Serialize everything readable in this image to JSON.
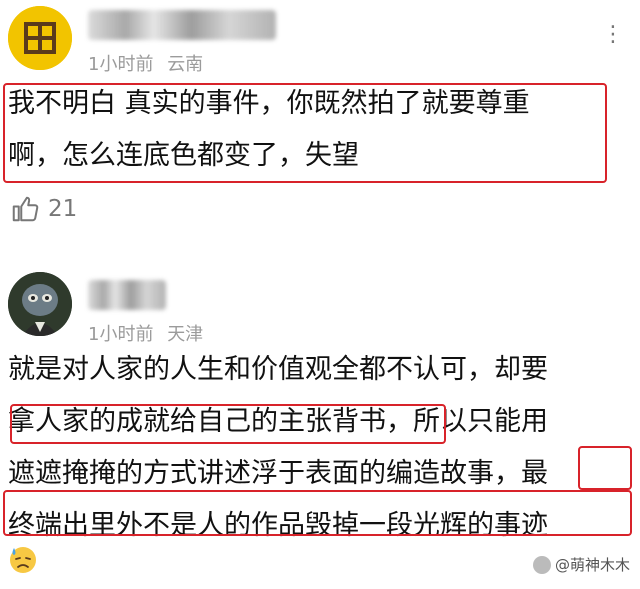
{
  "comments": [
    {
      "time": "1小时前",
      "location": "云南",
      "more_label": "⋮",
      "lines": [
        "我不明白 真实的事件，你既然拍了就要尊重",
        "啊，怎么连底色都变了，失望"
      ],
      "likes": "21"
    },
    {
      "time": "1小时前",
      "location": "天津",
      "lines": [
        "就是对人家的人生和价值观全都不认可，却要",
        "拿人家的成就给自己的主张背书，所以只能用",
        "遮遮掩掩的方式讲述浮于表面的编造故事，最",
        "终端出里外不是人的作品毁掉一段光辉的事迹"
      ]
    }
  ],
  "watermark": "@萌神木木",
  "colors": {
    "highlight": "#d8232a",
    "meta": "#9b9b9b"
  },
  "icons": [
    "thumbs-up-icon",
    "sweat-emoji-icon",
    "more-icon"
  ]
}
